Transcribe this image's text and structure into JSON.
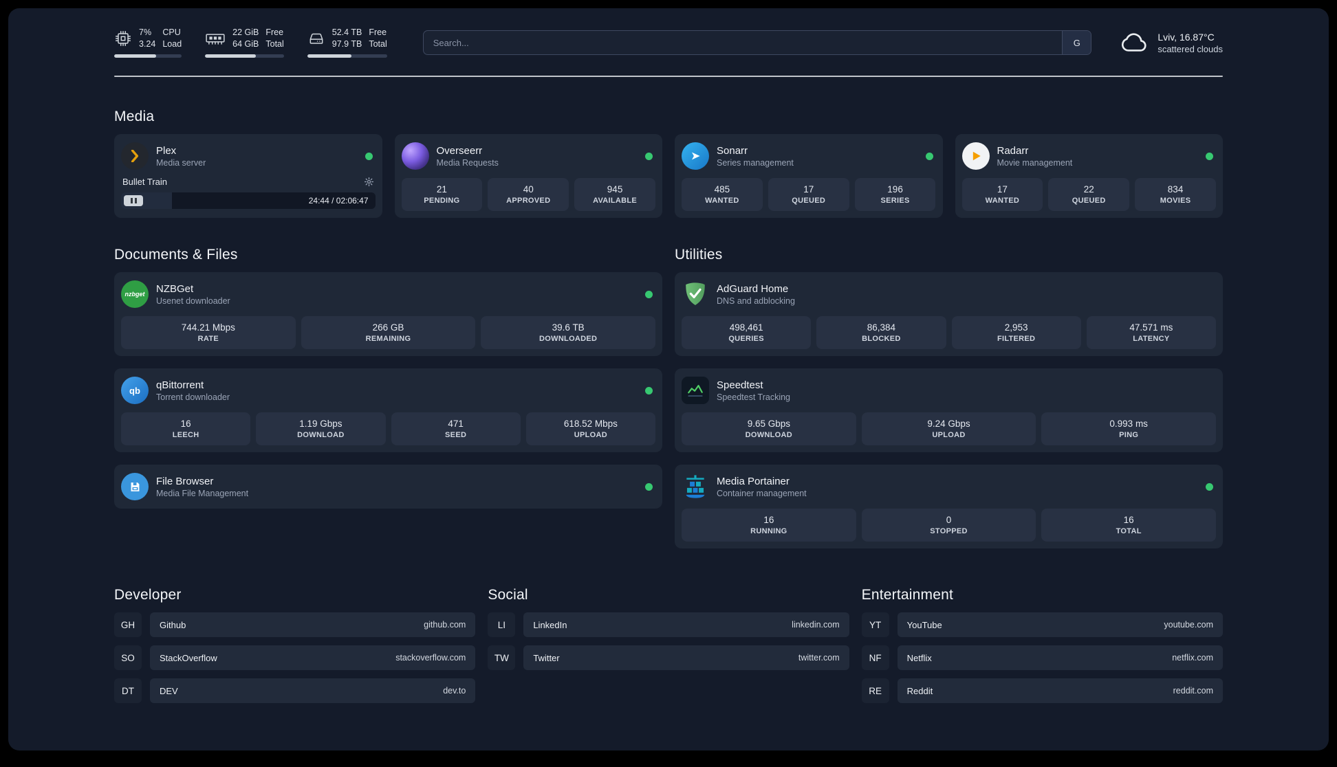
{
  "colors": {
    "background": "#141b2a",
    "card": "#1f2837",
    "status_online": "#37c871",
    "plex_accent": "#e5a00d",
    "adguard_green": "#5ba963",
    "portainer_blue": "#1c7ed6"
  },
  "topbar": {
    "cpu": {
      "value1": "7%",
      "value2": "3.24",
      "label1": "CPU",
      "label2": "Load",
      "progress": 62
    },
    "ram": {
      "value1": "22 GiB",
      "value2": "64 GiB",
      "label1": "Free",
      "label2": "Total",
      "progress": 64
    },
    "disk": {
      "value1": "52.4 TB",
      "value2": "97.9 TB",
      "label1": "Free",
      "label2": "Total",
      "progress": 55
    },
    "search": {
      "placeholder": "Search...",
      "engine_label": "G"
    },
    "weather": {
      "location": "Lviv, 16.87°C",
      "condition": "scattered clouds"
    }
  },
  "media": {
    "title": "Media",
    "plex": {
      "name": "Plex",
      "subtitle": "Media server",
      "now_playing": "Bullet Train",
      "time": "24:44 / 02:06:47",
      "progress": 20
    },
    "overseerr": {
      "name": "Overseerr",
      "subtitle": "Media Requests",
      "stats": [
        {
          "value": "21",
          "label": "PENDING"
        },
        {
          "value": "40",
          "label": "APPROVED"
        },
        {
          "value": "945",
          "label": "AVAILABLE"
        }
      ]
    },
    "sonarr": {
      "name": "Sonarr",
      "subtitle": "Series management",
      "stats": [
        {
          "value": "485",
          "label": "WANTED"
        },
        {
          "value": "17",
          "label": "QUEUED"
        },
        {
          "value": "196",
          "label": "SERIES"
        }
      ]
    },
    "radarr": {
      "name": "Radarr",
      "subtitle": "Movie management",
      "stats": [
        {
          "value": "17",
          "label": "WANTED"
        },
        {
          "value": "22",
          "label": "QUEUED"
        },
        {
          "value": "834",
          "label": "MOVIES"
        }
      ]
    }
  },
  "documents": {
    "title": "Documents & Files",
    "nzbget": {
      "name": "NZBGet",
      "subtitle": "Usenet downloader",
      "icon_text": "nzbget",
      "stats": [
        {
          "value": "744.21 Mbps",
          "label": "RATE"
        },
        {
          "value": "266 GB",
          "label": "REMAINING"
        },
        {
          "value": "39.6 TB",
          "label": "DOWNLOADED"
        }
      ]
    },
    "qbittorrent": {
      "name": "qBittorrent",
      "subtitle": "Torrent downloader",
      "icon_text": "qb",
      "stats": [
        {
          "value": "16",
          "label": "LEECH"
        },
        {
          "value": "1.19 Gbps",
          "label": "DOWNLOAD"
        },
        {
          "value": "471",
          "label": "SEED"
        },
        {
          "value": "618.52 Mbps",
          "label": "UPLOAD"
        }
      ]
    },
    "filebrowser": {
      "name": "File Browser",
      "subtitle": "Media File Management"
    }
  },
  "utilities": {
    "title": "Utilities",
    "adguard": {
      "name": "AdGuard Home",
      "subtitle": "DNS and adblocking",
      "stats": [
        {
          "value": "498,461",
          "label": "QUERIES"
        },
        {
          "value": "86,384",
          "label": "BLOCKED"
        },
        {
          "value": "2,953",
          "label": "FILTERED"
        },
        {
          "value": "47.571 ms",
          "label": "LATENCY"
        }
      ]
    },
    "speedtest": {
      "name": "Speedtest",
      "subtitle": "Speedtest Tracking",
      "stats": [
        {
          "value": "9.65 Gbps",
          "label": "DOWNLOAD"
        },
        {
          "value": "9.24 Gbps",
          "label": "UPLOAD"
        },
        {
          "value": "0.993 ms",
          "label": "PING"
        }
      ]
    },
    "portainer": {
      "name": "Media Portainer",
      "subtitle": "Container management",
      "stats": [
        {
          "value": "16",
          "label": "RUNNING"
        },
        {
          "value": "0",
          "label": "STOPPED"
        },
        {
          "value": "16",
          "label": "TOTAL"
        }
      ]
    }
  },
  "bookmarks": [
    {
      "title": "Developer",
      "items": [
        {
          "abbr": "GH",
          "name": "Github",
          "url": "github.com"
        },
        {
          "abbr": "SO",
          "name": "StackOverflow",
          "url": "stackoverflow.com"
        },
        {
          "abbr": "DT",
          "name": "DEV",
          "url": "dev.to"
        }
      ]
    },
    {
      "title": "Social",
      "items": [
        {
          "abbr": "LI",
          "name": "LinkedIn",
          "url": "linkedin.com"
        },
        {
          "abbr": "TW",
          "name": "Twitter",
          "url": "twitter.com"
        }
      ]
    },
    {
      "title": "Entertainment",
      "items": [
        {
          "abbr": "YT",
          "name": "YouTube",
          "url": "youtube.com"
        },
        {
          "abbr": "NF",
          "name": "Netflix",
          "url": "netflix.com"
        },
        {
          "abbr": "RE",
          "name": "Reddit",
          "url": "reddit.com"
        }
      ]
    }
  ]
}
